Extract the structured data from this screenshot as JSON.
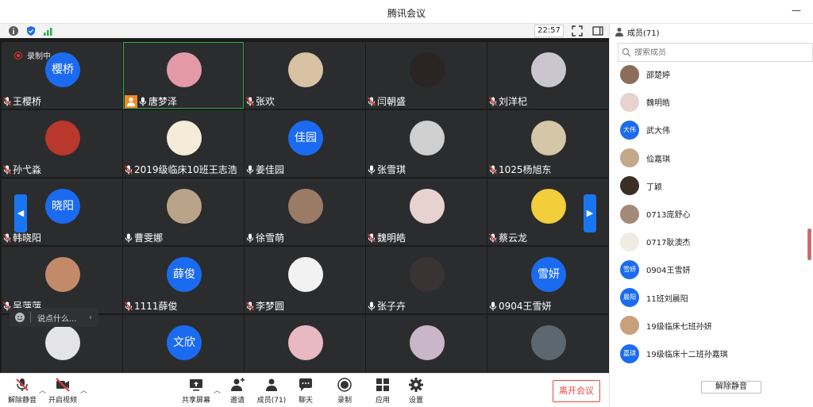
{
  "window": {
    "title": "腾讯会议",
    "minimize": "—",
    "maximize": "□"
  },
  "info": {
    "time": "22:57"
  },
  "recording": {
    "label": "录制中"
  },
  "chat": {
    "placeholder": "说点什么..."
  },
  "colors": {
    "accent": "#1b6bf0",
    "host_badge": "#f08a24",
    "active_outline": "#2cae4e",
    "leave": "#ee4444",
    "muted_mic": "#e33b3b"
  },
  "tiles": [
    {
      "name": "王樱桥",
      "avatar_text": "樱桥",
      "avatar_color": "#1b6bf0",
      "muted": true
    },
    {
      "name": "唐梦泽",
      "avatar_text": "",
      "avatar_color": "#e49aa6",
      "muted": false,
      "host": true,
      "active": true
    },
    {
      "name": "张欢",
      "avatar_text": "",
      "avatar_color": "#d9c1a4",
      "muted": true
    },
    {
      "name": "闫朝盛",
      "avatar_text": "",
      "avatar_color": "#2a2423",
      "muted": true
    },
    {
      "name": "刘洋杞",
      "avatar_text": "",
      "avatar_color": "#c9c7cd",
      "muted": true
    },
    {
      "name": "孙弋淼",
      "avatar_text": "",
      "avatar_color": "#b9372c",
      "muted": true
    },
    {
      "name": "2019级临床10班王志浩",
      "avatar_text": "",
      "avatar_color": "#f4ebd9",
      "muted": true
    },
    {
      "name": "姜佳园",
      "avatar_text": "佳园",
      "avatar_color": "#1b6bf0",
      "muted": false
    },
    {
      "name": "张雪琪",
      "avatar_text": "",
      "avatar_color": "#cfcfcf",
      "muted": false
    },
    {
      "name": "1025杨旭东",
      "avatar_text": "",
      "avatar_color": "#d4c6a7",
      "muted": true
    },
    {
      "name": "韩晓阳",
      "avatar_text": "晓阳",
      "avatar_color": "#1b6bf0",
      "muted": true
    },
    {
      "name": "曹雯娜",
      "avatar_text": "",
      "avatar_color": "#b9a48a",
      "muted": false
    },
    {
      "name": "徐雪萌",
      "avatar_text": "",
      "avatar_color": "#9b7b66",
      "muted": false
    },
    {
      "name": "魏明皓",
      "avatar_text": "",
      "avatar_color": "#e7d2cf",
      "muted": true
    },
    {
      "name": "蔡云龙",
      "avatar_text": "",
      "avatar_color": "#f2cd3c",
      "muted": true
    },
    {
      "name": "吴萍萍",
      "avatar_text": "",
      "avatar_color": "#c38a6a",
      "muted": true
    },
    {
      "name": "1111薛俊",
      "avatar_text": "薛俊",
      "avatar_color": "#1b6bf0",
      "muted": true
    },
    {
      "name": "李梦圆",
      "avatar_text": "",
      "avatar_color": "#f2f2f2",
      "muted": true
    },
    {
      "name": "张子卉",
      "avatar_text": "",
      "avatar_color": "#3a3333",
      "muted": false
    },
    {
      "name": "0904王雪妍",
      "avatar_text": "雪妍",
      "avatar_color": "#1b6bf0",
      "muted": false
    },
    {
      "name": "",
      "avatar_text": "",
      "avatar_color": "#e4e4e8",
      "muted": false
    },
    {
      "name": "",
      "avatar_text": "文欣",
      "avatar_color": "#1b6bf0",
      "muted": false
    },
    {
      "name": "",
      "avatar_text": "",
      "avatar_color": "#e8b9c2",
      "muted": false
    },
    {
      "name": "",
      "avatar_text": "",
      "avatar_color": "#c9b7c9",
      "muted": false
    },
    {
      "name": "",
      "avatar_text": "",
      "avatar_color": "#5d6770",
      "muted": false
    }
  ],
  "toolbar": {
    "unmute": "解除静音",
    "start_video": "开启视频",
    "share": "共享屏幕",
    "invite": "邀请",
    "members": "成员(71)",
    "chat": "聊天",
    "record": "录制",
    "apps": "应用",
    "settings": "设置",
    "leave": "离开会议"
  },
  "panel": {
    "title": "成员(71)",
    "search_placeholder": "搜索成员",
    "unmute_all": "解除静音",
    "members": [
      {
        "name": "邵楚婷",
        "avatar_text": "",
        "avatar_color": "#8a6d5a"
      },
      {
        "name": "魏明皓",
        "avatar_text": "",
        "avatar_color": "#e7d2cf"
      },
      {
        "name": "武大伟",
        "avatar_text": "大伟",
        "avatar_color": "#1b6bf0"
      },
      {
        "name": "佡嘉琪",
        "avatar_text": "",
        "avatar_color": "#c4a88a"
      },
      {
        "name": "丁颖",
        "avatar_text": "",
        "avatar_color": "#3b2e27"
      },
      {
        "name": "0713庞舒心",
        "avatar_text": "",
        "avatar_color": "#a38a78"
      },
      {
        "name": "0717耿澳杰",
        "avatar_text": "",
        "avatar_color": "#f0ece4"
      },
      {
        "name": "0904王雪妍",
        "avatar_text": "雪妍",
        "avatar_color": "#1b6bf0"
      },
      {
        "name": "11班刘晨阳",
        "avatar_text": "晨阳",
        "avatar_color": "#1b6bf0"
      },
      {
        "name": "19级临床七班孙妍",
        "avatar_text": "",
        "avatar_color": "#c8a07c"
      },
      {
        "name": "19级临床十二班孙嘉琪",
        "avatar_text": "嘉琪",
        "avatar_color": "#1b6bf0"
      }
    ]
  }
}
